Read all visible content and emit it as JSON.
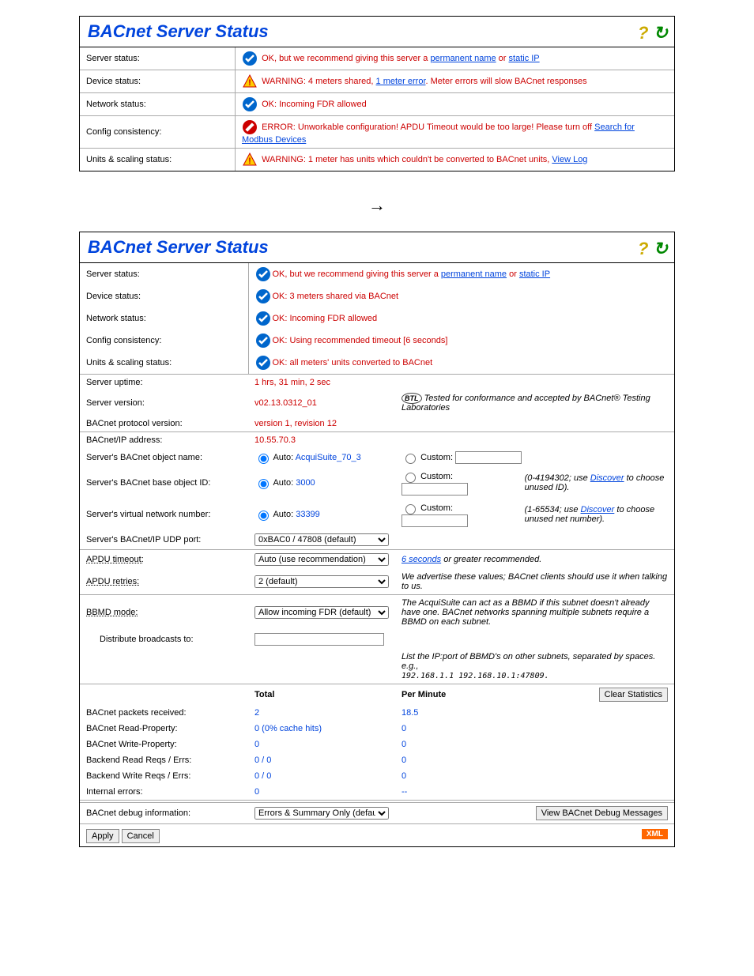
{
  "title": "BACnet Server Status",
  "panel1": {
    "rows": {
      "server_status": {
        "label": "Server status:",
        "icon": "ok",
        "pre": "OK, but we recommend giving this server a ",
        "link1": "permanent name",
        "mid": " or ",
        "link2": "static IP"
      },
      "device_status": {
        "label": "Device status:",
        "icon": "warn",
        "pre": "WARNING: 4 meters shared, ",
        "link1": "1 meter error",
        "post": ". Meter errors will slow BACnet responses"
      },
      "network_status": {
        "label": "Network status:",
        "icon": "ok",
        "text": "OK: Incoming FDR allowed"
      },
      "config_consistency": {
        "label": "Config consistency:",
        "icon": "err",
        "pre": "ERROR: Unworkable configuration! APDU Timeout would be too large! Please turn off ",
        "link1": "Search for Modbus Devices"
      },
      "units_scaling": {
        "label": "Units & scaling status:",
        "icon": "warn",
        "pre": "WARNING: 1 meter has units which couldn't be converted to BACnet units, ",
        "link1": "View Log"
      }
    }
  },
  "panel2": {
    "s1": {
      "server_status": {
        "label": "Server status:",
        "icon": "ok",
        "pre": "OK, but we recommend giving this server a ",
        "link1": "permanent name",
        "mid": " or ",
        "link2": "static IP"
      },
      "device_status": {
        "label": "Device status:",
        "icon": "ok",
        "text": "OK: 3 meters shared via BACnet"
      },
      "network_status": {
        "label": "Network status:",
        "icon": "ok",
        "text": "OK: Incoming FDR allowed"
      },
      "config_consistency": {
        "label": "Config consistency:",
        "icon": "ok",
        "text": "OK: Using recommended timeout [6 seconds]"
      },
      "units_scaling": {
        "label": "Units & scaling status:",
        "icon": "ok",
        "text": "OK: all meters' units converted to BACnet"
      }
    },
    "s2": {
      "uptime": {
        "label": "Server uptime:",
        "val": "1 hrs, 31 min, 2 sec"
      },
      "version": {
        "label": "Server version:",
        "val": "v02.13.0312_01",
        "note": "Tested for conformance and accepted by BACnet® Testing Laboratories"
      },
      "protocol": {
        "label": "BACnet protocol version:",
        "val": "version 1, revision 12"
      }
    },
    "s3": {
      "ip": {
        "label": "BACnet/IP address:",
        "val": "10.55.70.3"
      },
      "objname": {
        "label": "Server's BACnet object name:",
        "auto": "Auto: ",
        "autoval": "AcquiSuite_70_3",
        "custom": "Custom:"
      },
      "baseid": {
        "label": "Server's BACnet base object ID:",
        "auto": "Auto: ",
        "autoval": "3000",
        "custom": "Custom:",
        "hint_pre": "(0-4194302; use ",
        "hint_link": "Discover",
        "hint_post": " to choose unused ID)."
      },
      "vnet": {
        "label": "Server's virtual network number:",
        "auto": "Auto: ",
        "autoval": "33399",
        "custom": "Custom:",
        "hint_pre": "(1-65534; use ",
        "hint_link": "Discover",
        "hint_post": " to choose unused net number)."
      },
      "udp": {
        "label": "Server's BACnet/IP UDP port:",
        "sel": "0xBAC0 / 47808 (default)"
      }
    },
    "s4": {
      "apdu_timeout": {
        "label": "APDU timeout:",
        "sel": "Auto (use recommendation)",
        "hint_pre": "",
        "hint_em": "6 seconds",
        "hint_post": " or greater recommended."
      },
      "apdu_retries": {
        "label": "APDU retries:",
        "sel": "2 (default)",
        "hint": "We advertise these values; BACnet clients should use it when talking to us."
      }
    },
    "s5": {
      "bbmd": {
        "label": "BBMD mode:",
        "sel": "Allow incoming FDR (default)",
        "hint": "The AcquiSuite can act as a BBMD if this subnet doesn't already have one. BACnet networks spanning multiple subnets require a BBMD on each subnet."
      },
      "dist": {
        "label": "Distribute broadcasts to:",
        "hint": "List the IP:port of BBMD's on other subnets, separated by spaces. e.g.,",
        "eg": "192.168.1.1 192.168.10.1:47809."
      }
    },
    "stats": {
      "h_total": "Total",
      "h_pm": "Per Minute",
      "clear": "Clear Statistics",
      "rows": [
        {
          "label": "BACnet packets received:",
          "total": "2",
          "pm": "18.5"
        },
        {
          "label": "BACnet Read-Property:",
          "total": "0 (0% cache hits)",
          "pm": "0"
        },
        {
          "label": "BACnet Write-Property:",
          "total": "0",
          "pm": "0"
        },
        {
          "label": "Backend Read Reqs / Errs:",
          "total": "0 / 0",
          "pm": "0"
        },
        {
          "label": "Backend Write Reqs / Errs:",
          "total": "0 / 0",
          "pm": "0"
        },
        {
          "label": "Internal errors:",
          "total": "0",
          "pm": "--"
        }
      ]
    },
    "debug": {
      "label": "BACnet debug information:",
      "sel": "Errors & Summary Only (default)",
      "btn": "View BACnet Debug Messages"
    },
    "footer": {
      "apply": "Apply",
      "cancel": "Cancel",
      "xml": "XML"
    }
  }
}
